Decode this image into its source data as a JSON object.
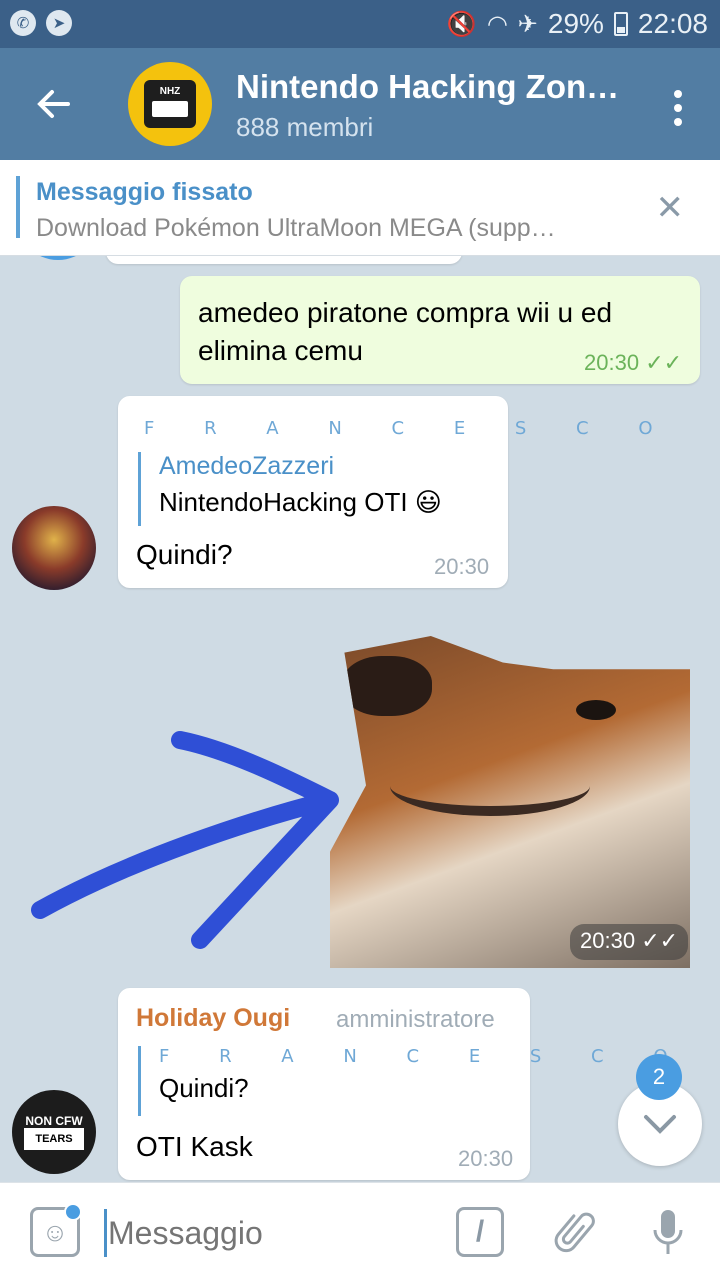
{
  "status_bar": {
    "battery": "29%",
    "time": "22:08"
  },
  "header": {
    "title": "Nintendo Hacking Zon…",
    "subtitle": "888 membri",
    "avatar_text": "NHZ"
  },
  "pinned": {
    "title": "Messaggio fissato",
    "text": "Download Pokémon UltraMoon  MEGA (supp…"
  },
  "messages": [
    {
      "text": "amedeo piratone compra wii u ed elimina cemu",
      "time": "20:30"
    },
    {
      "sender": "F R A N C E S C O",
      "reply_name": "AmedeoZazzeri",
      "reply_text": "NintendoHacking OTI 😃",
      "text": "Quindi?",
      "time": "20:30"
    },
    {
      "sticker_time": "20:30"
    },
    {
      "sender": "Holiday Ougi",
      "role": "amministratore",
      "reply_name": "F R A N C E S C O",
      "reply_text": "Quindi?",
      "text": "OTI Kask",
      "time": "20:30"
    }
  ],
  "unread_badge": "2",
  "input": {
    "placeholder": "Messaggio"
  },
  "colors": {
    "header": "#527da3",
    "status_bar": "#3b6088",
    "outgoing_bubble": "#effdde",
    "link_blue": "#4a90c8",
    "admin_orange": "#d07838"
  }
}
